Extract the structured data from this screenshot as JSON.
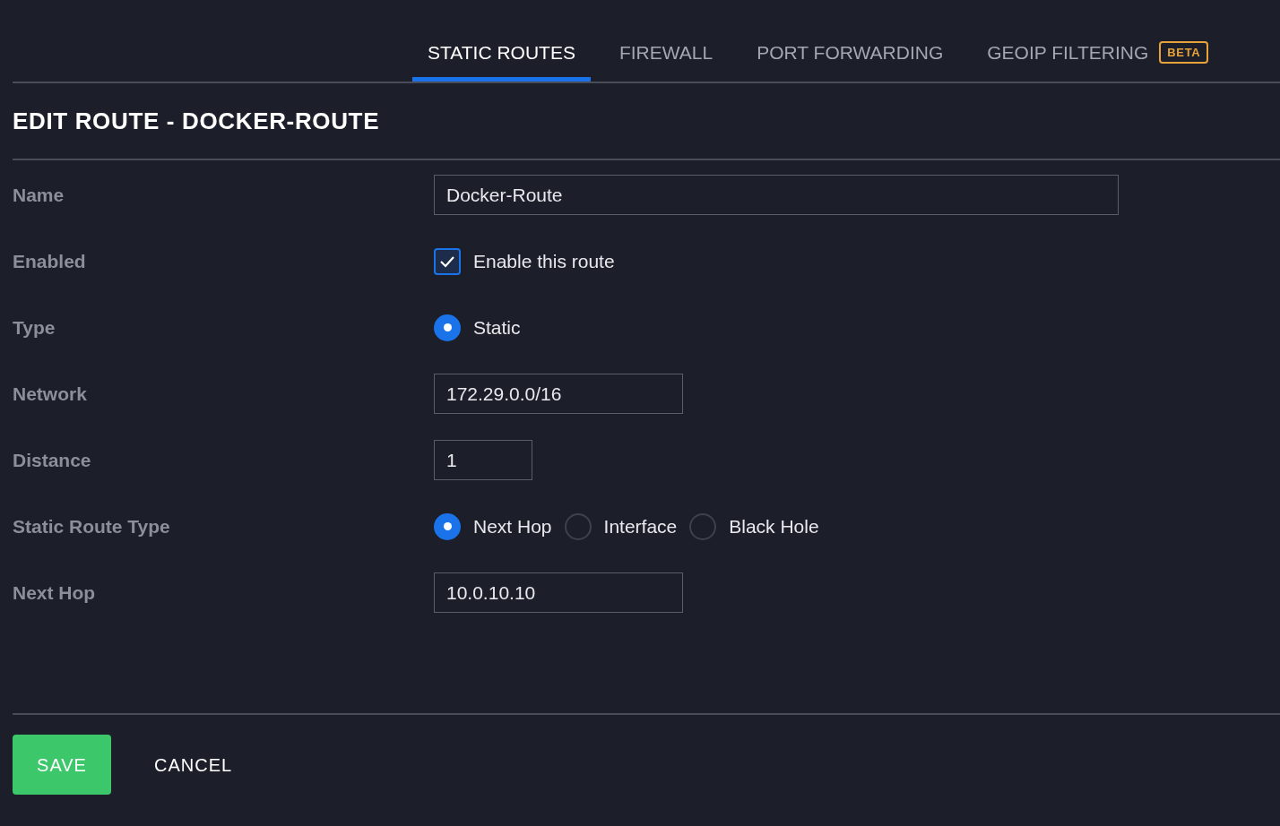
{
  "tabs": [
    {
      "label": "STATIC ROUTES",
      "selected": true
    },
    {
      "label": "FIREWALL",
      "selected": false
    },
    {
      "label": "PORT FORWARDING",
      "selected": false
    },
    {
      "label": "GEOIP FILTERING",
      "selected": false,
      "badge": "BETA"
    }
  ],
  "title": "EDIT ROUTE - DOCKER-ROUTE",
  "fields": [
    {
      "label": "Name",
      "kind": "text",
      "value": "Docker-Route"
    },
    {
      "label": "Enabled",
      "kind": "checkbox",
      "checked": true,
      "text": "Enable this route"
    },
    {
      "label": "Type",
      "kind": "radio",
      "options": [
        {
          "label": "Static",
          "selected": true
        }
      ]
    },
    {
      "label": "Network",
      "kind": "text",
      "value": "172.29.0.0/16"
    },
    {
      "label": "Distance",
      "kind": "text",
      "value": "1"
    },
    {
      "label": "Static Route Type",
      "kind": "radio",
      "options": [
        {
          "label": "Next Hop",
          "selected": true
        },
        {
          "label": "Interface",
          "selected": false
        },
        {
          "label": "Black Hole",
          "selected": false
        }
      ]
    },
    {
      "label": "Next Hop",
      "kind": "text",
      "value": "10.0.10.10"
    }
  ],
  "buttons": [
    {
      "label": "SAVE",
      "kind": "primary"
    },
    {
      "label": "CANCEL",
      "kind": "plain"
    }
  ]
}
